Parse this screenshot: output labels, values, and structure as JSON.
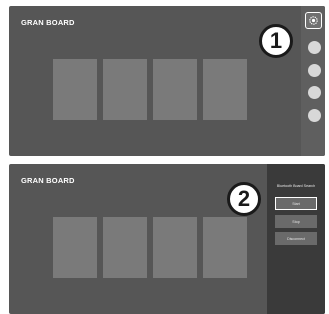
{
  "top_screen": {
    "app_title": "GRAN BOARD",
    "callout_number": "1",
    "settings_icon": "gear-icon",
    "side_buttons_count": 4
  },
  "bottom_screen": {
    "app_title": "GRAN BOARD",
    "callout_number": "2",
    "panel": {
      "title": "Bluetooth Board Search",
      "start_label": "Start",
      "stop_label": "Stop",
      "disconnect_label": "Disconnect"
    }
  }
}
